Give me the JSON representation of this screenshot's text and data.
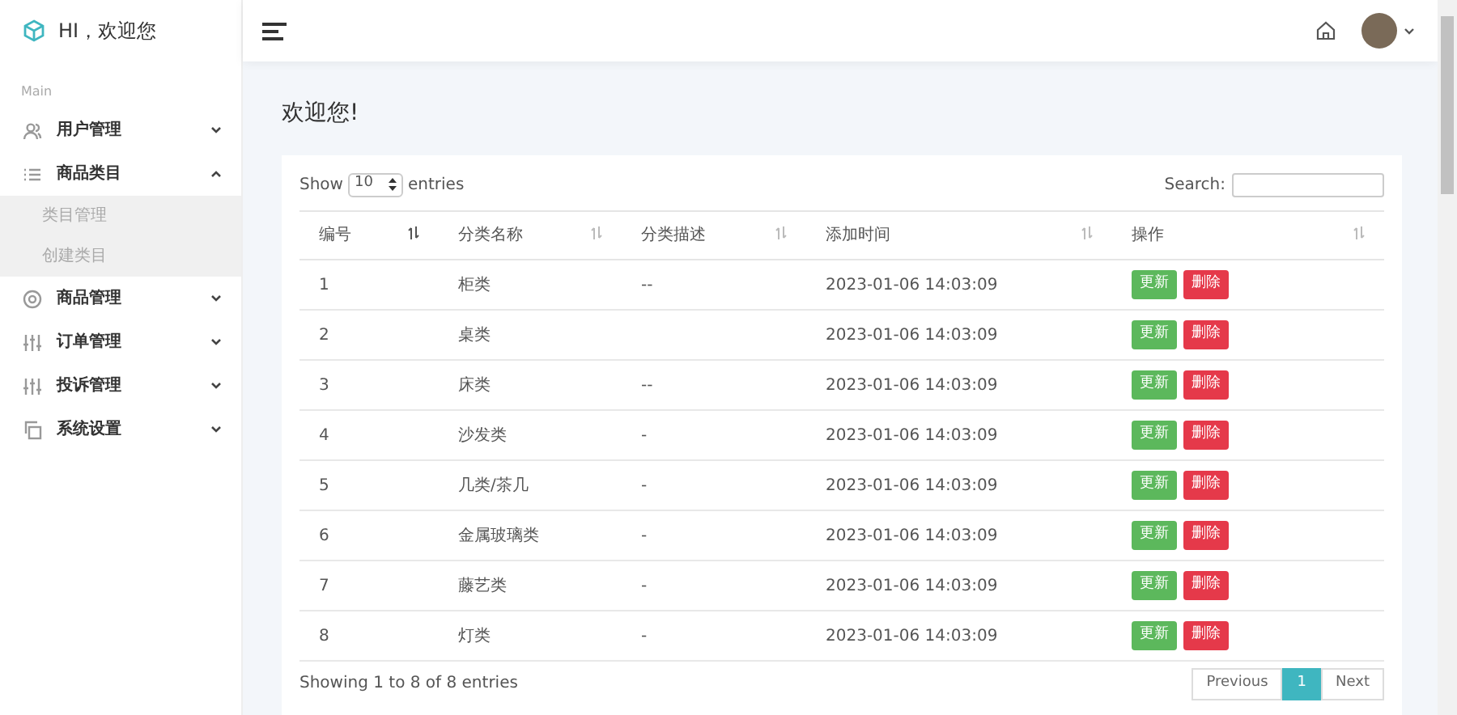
{
  "brand": {
    "title": "HI，欢迎您"
  },
  "sidebar": {
    "section": "Main",
    "items": [
      {
        "label": "用户管理",
        "expanded": false
      },
      {
        "label": "商品类目",
        "expanded": true,
        "children": [
          {
            "label": "类目管理"
          },
          {
            "label": "创建类目"
          }
        ]
      },
      {
        "label": "商品管理",
        "expanded": false
      },
      {
        "label": "订单管理",
        "expanded": false
      },
      {
        "label": "投诉管理",
        "expanded": false
      },
      {
        "label": "系统设置",
        "expanded": false
      }
    ]
  },
  "page_title": "欢迎您!",
  "table_controls": {
    "show": "Show",
    "page_size": "10",
    "entries": "entries",
    "search": "Search:"
  },
  "table": {
    "columns": [
      "编号",
      "分类名称",
      "分类描述",
      "添加时间",
      "操作"
    ],
    "rows": [
      {
        "id": "1",
        "name": "柜类",
        "desc": "--",
        "time": "2023-01-06 14:03:09",
        "actions": [
          "更新",
          "删除"
        ]
      },
      {
        "id": "2",
        "name": "桌类",
        "time": "2023-01-06 14:03:09",
        "actions": [
          "更新",
          "删除"
        ]
      },
      {
        "id": "3",
        "name": "床类",
        "desc": "--",
        "time": "2023-01-06 14:03:09",
        "actions": [
          "更新",
          "删除"
        ]
      },
      {
        "id": "4",
        "name": "沙发类",
        "desc": "-",
        "time": "2023-01-06 14:03:09",
        "actions": [
          "更新",
          "删除"
        ]
      },
      {
        "id": "5",
        "name": "几类/茶几",
        "desc": "-",
        "time": "2023-01-06 14:03:09",
        "actions": [
          "更新",
          "删除"
        ]
      },
      {
        "id": "6",
        "name": "金属玻璃类",
        "desc": "-",
        "time": "2023-01-06 14:03:09",
        "actions": [
          "更新",
          "删除"
        ]
      },
      {
        "id": "7",
        "name": "藤艺类",
        "desc": "-",
        "time": "2023-01-06 14:03:09",
        "actions": [
          "更新",
          "删除"
        ]
      },
      {
        "id": "8",
        "name": "灯类",
        "desc": "-",
        "time": "2023-01-06 14:03:09",
        "actions": [
          "更新",
          "删除"
        ]
      }
    ]
  },
  "footer": {
    "info": "Showing 1 to 8 of 8 entries",
    "pagination": [
      {
        "label": "Previous",
        "selected": false
      },
      {
        "label": "1",
        "selected": true
      },
      {
        "label": "Next",
        "selected": false
      }
    ]
  }
}
